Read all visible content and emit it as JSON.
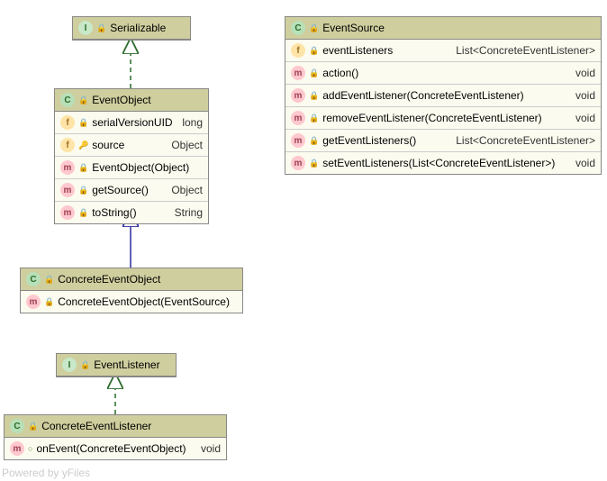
{
  "classes": {
    "serializable": {
      "name": "Serializable"
    },
    "eventObject": {
      "name": "EventObject",
      "fields": [
        {
          "name": "serialVersionUID",
          "type": "long"
        },
        {
          "name": "source",
          "type": "Object"
        }
      ],
      "methods": [
        {
          "name": "EventObject(Object)",
          "type": ""
        },
        {
          "name": "getSource()",
          "type": "Object"
        },
        {
          "name": "toString()",
          "type": "String"
        }
      ]
    },
    "concreteEventObject": {
      "name": "ConcreteEventObject",
      "methods": [
        {
          "name": "ConcreteEventObject(EventSource)",
          "type": ""
        }
      ]
    },
    "eventListener": {
      "name": "EventListener"
    },
    "concreteEventListener": {
      "name": "ConcreteEventListener",
      "methods": [
        {
          "name": "onEvent(ConcreteEventObject)",
          "type": "void"
        }
      ]
    },
    "eventSource": {
      "name": "EventSource",
      "fields": [
        {
          "name": "eventListeners",
          "type": "List<ConcreteEventListener>"
        }
      ],
      "methods": [
        {
          "name": "action()",
          "type": "void"
        },
        {
          "name": "addEventListener(ConcreteEventListener)",
          "type": "void"
        },
        {
          "name": "removeEventListener(ConcreteEventListener)",
          "type": "void"
        },
        {
          "name": "getEventListeners()",
          "type": "List<ConcreteEventListener>"
        },
        {
          "name": "setEventListeners(List<ConcreteEventListener>)",
          "type": "void"
        }
      ]
    }
  },
  "watermark": "Powered by yFiles"
}
